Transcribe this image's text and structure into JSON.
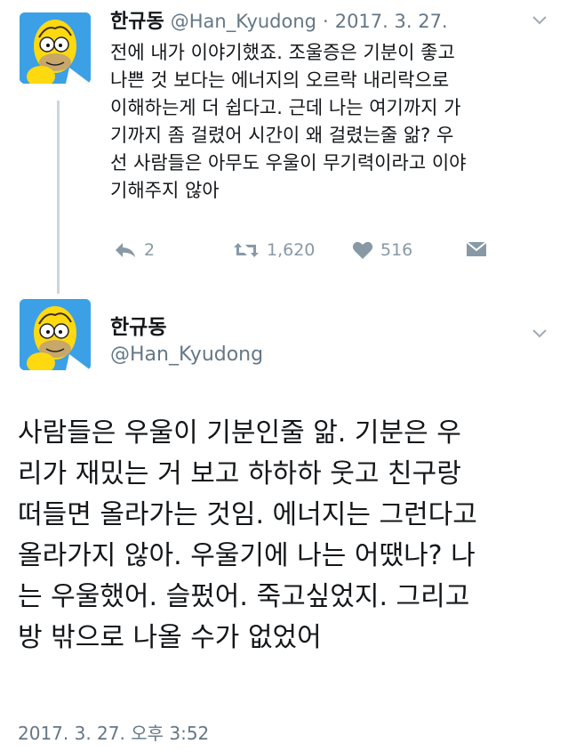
{
  "tweet1": {
    "name": "한규동",
    "handle": "@Han_Kyudong",
    "separator": "·",
    "date": "2017. 3. 27.",
    "lines": [
      "전에 내가 이야기했죠. 조울증은 기분이 좋고",
      "나쁜 것 보다는 에너지의 오르락 내리락으로",
      "이해하는게 더 쉽다고. 근데 나는 여기까지 가",
      "기까지 좀 걸렸어 시간이 왜 걸렸는줄 앎? 우",
      "선 사람들은 아무도 우울이 무기력이라고 이야",
      "기해주지 않아"
    ],
    "reply_count": "2",
    "retweet_count": "1,620",
    "like_count": "516",
    "reply_icon": "reply-icon",
    "retweet_icon": "retweet-icon",
    "like_icon": "heart-icon",
    "dm_icon": "envelope-icon"
  },
  "tweet2": {
    "name": "한규동",
    "handle": "@Han_Kyudong",
    "lines": [
      "사람들은 우울이 기분인줄 앎. 기분은 우",
      "리가 재밌는 거 보고 하하하 웃고 친구랑",
      "떠들면 올라가는 것임. 에너지는 그런다고",
      "올라가지 않아. 우울기에 나는 어땠나? 나",
      "는 우울했어. 슬펐어. 죽고싶었지. 그리고",
      "방 밖으로 나올 수가 없었어"
    ],
    "timestamp": "2017. 3. 27. 오후 3:52"
  },
  "colors": {
    "text": "#14171a",
    "secondary": "#657786",
    "icon": "#8899a6",
    "thread_line": "#ccd6dd",
    "avatar_bg": "#3ca0e6"
  }
}
